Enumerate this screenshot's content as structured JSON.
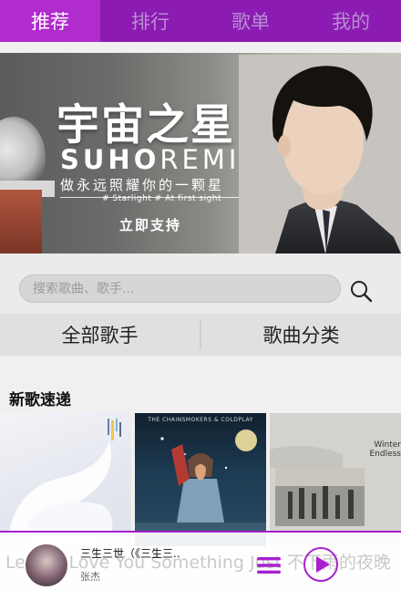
{
  "tabs": [
    {
      "label": "推荐",
      "active": true
    },
    {
      "label": "排行"
    },
    {
      "label": "歌单"
    },
    {
      "label": "我的"
    }
  ],
  "banner": {
    "title": "宇宙之星",
    "subtitle_bold": "SUHO",
    "subtitle_rest": "REMI",
    "tagline": "做永远照耀你的一颗星",
    "small": "# Starlight  # At first sight",
    "cta": "立即支持"
  },
  "search": {
    "placeholder": "搜索歌曲、歌手..."
  },
  "categories": {
    "all_singers": "全部歌手",
    "song_categories": "歌曲分类"
  },
  "section": {
    "new_songs": "新歌速递"
  },
  "albums": [
    {
      "caption": ""
    },
    {
      "caption": "THE CHAINSMOKERS & COLDPLAY"
    },
    {
      "caption": "Winter Endless"
    }
  ],
  "player": {
    "lyric": "Let Me Love You Something Just   不下雨的夜晚",
    "song_title": "三生三世（《三生三...",
    "artist": "张杰"
  },
  "colors": {
    "tab_bar": "#8c1bb3",
    "tab_active": "#b02ccc",
    "accent": "#a81fd0"
  }
}
